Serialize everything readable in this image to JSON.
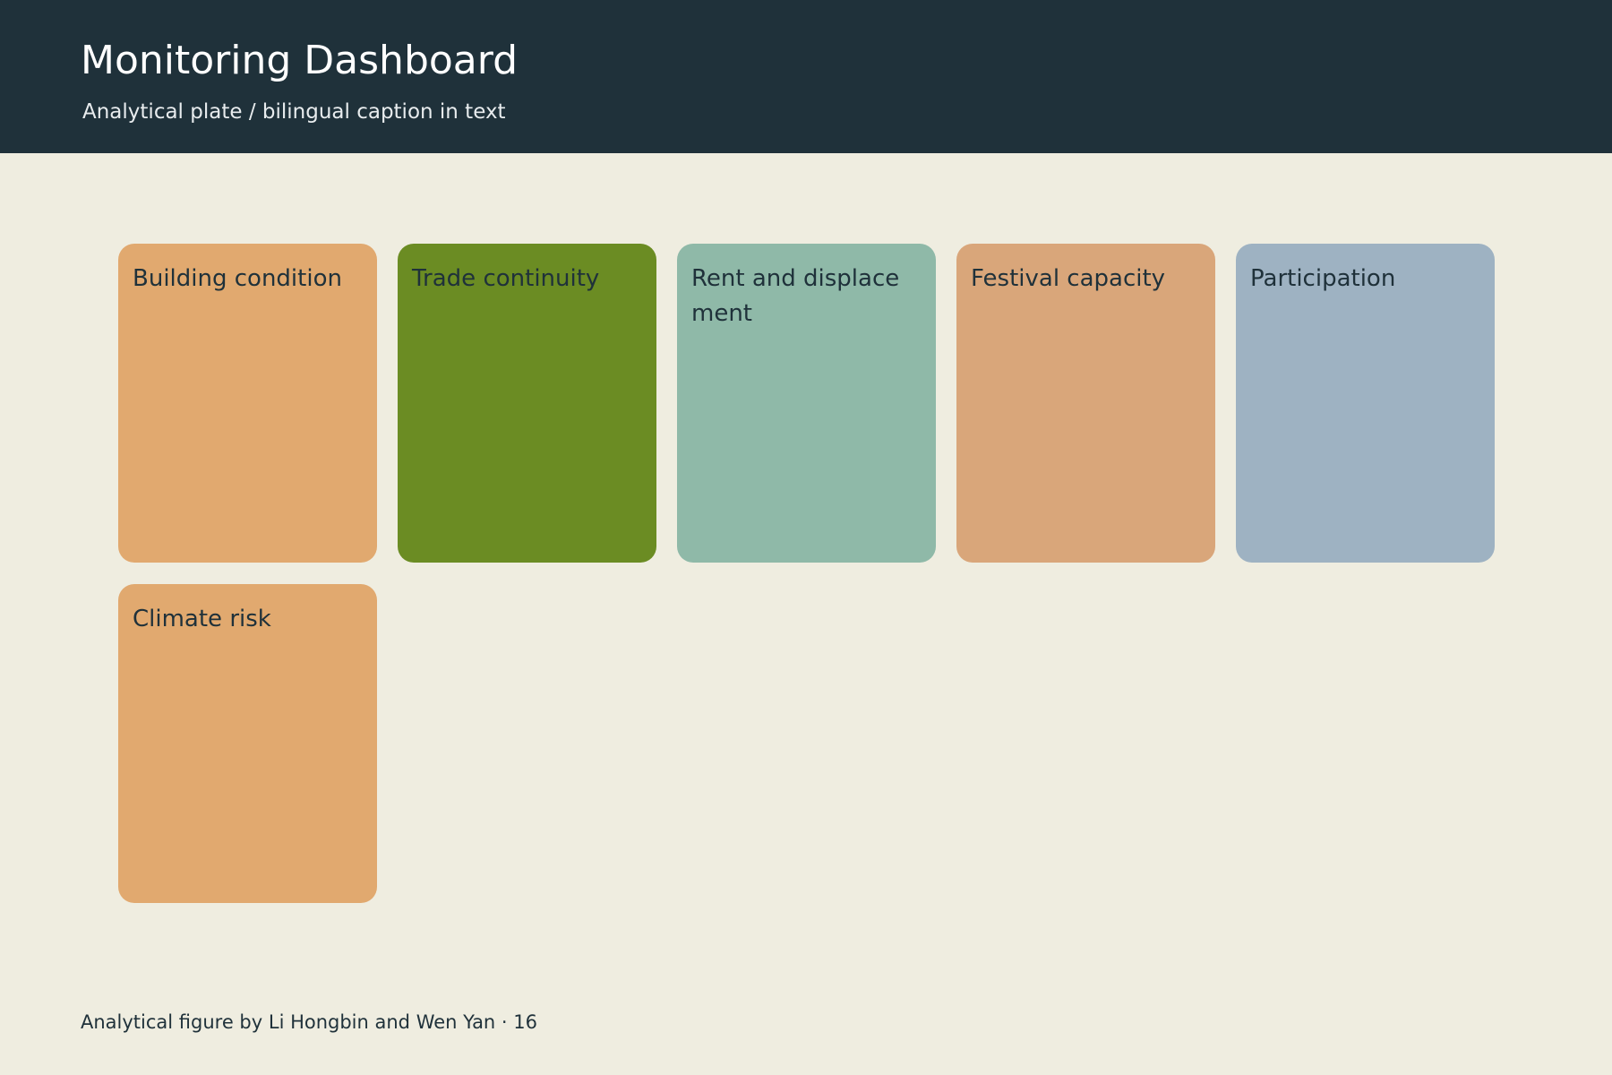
{
  "header": {
    "title": "Monitoring Dashboard",
    "subtitle": "Analytical plate / bilingual caption in text"
  },
  "tiles": [
    {
      "label": "Building condition",
      "color": "#e1a96f"
    },
    {
      "label": "Trade continuity",
      "color": "#6b8c23"
    },
    {
      "label": "Rent and displacement",
      "color": "#8fb9a8"
    },
    {
      "label": "Festival capacity",
      "color": "#d9a67a"
    },
    {
      "label": "Participation",
      "color": "#9eb2c2"
    },
    {
      "label": "Climate risk",
      "color": "#e1a96f"
    }
  ],
  "footer": {
    "credit": "Analytical figure by Li Hongbin and Wen Yan · 16"
  }
}
